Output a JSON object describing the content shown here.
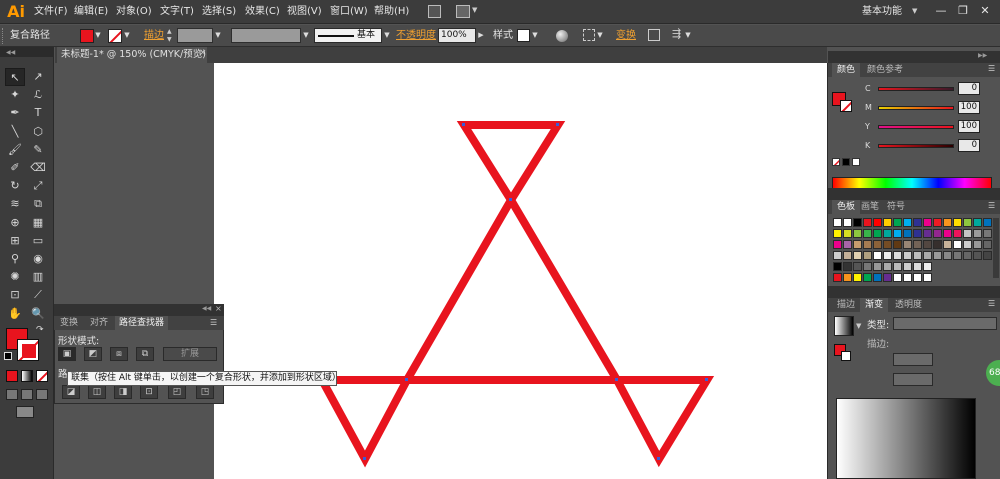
{
  "app": {
    "logo": "Ai"
  },
  "menu": [
    {
      "label": "文件(F)"
    },
    {
      "label": "编辑(E)"
    },
    {
      "label": "对象(O)"
    },
    {
      "label": "文字(T)"
    },
    {
      "label": "选择(S)"
    },
    {
      "label": "效果(C)"
    },
    {
      "label": "视图(V)"
    },
    {
      "label": "窗口(W)"
    },
    {
      "label": "帮助(H)"
    }
  ],
  "workspace": {
    "label": "基本功能"
  },
  "window_controls": {
    "minimize": "—",
    "maximize": "❐",
    "close": "✕"
  },
  "control": {
    "selection_type": "复合路径",
    "fill_color": "#e8141e",
    "stroke_label": "描边",
    "stroke_style_label": "基本",
    "opacity_label": "不透明度",
    "opacity_value": "100%",
    "style_label": "样式",
    "transform_label": "变换"
  },
  "document": {
    "tab_title": "未标题-1* @ 150% (CMYK/预览)"
  },
  "tools": [
    {
      "name": "selection-tool",
      "glyph": "↖"
    },
    {
      "name": "direct-selection-tool",
      "glyph": "↗"
    },
    {
      "name": "magic-wand-tool",
      "glyph": "✦"
    },
    {
      "name": "lasso-tool",
      "glyph": "ℒ"
    },
    {
      "name": "pen-tool",
      "glyph": "✒"
    },
    {
      "name": "type-tool",
      "glyph": "T"
    },
    {
      "name": "line-tool",
      "glyph": "╲"
    },
    {
      "name": "ellipse-tool",
      "glyph": "⬡"
    },
    {
      "name": "paintbrush-tool",
      "glyph": "🖌"
    },
    {
      "name": "pencil-tool",
      "glyph": "✎"
    },
    {
      "name": "blob-brush-tool",
      "glyph": "✐"
    },
    {
      "name": "eraser-tool",
      "glyph": "⌫"
    },
    {
      "name": "rotate-tool",
      "glyph": "↻"
    },
    {
      "name": "scale-tool",
      "glyph": "⤢"
    },
    {
      "name": "width-tool",
      "glyph": "≋"
    },
    {
      "name": "free-transform-tool",
      "glyph": "⧉"
    },
    {
      "name": "shape-builder-tool",
      "glyph": "⊕"
    },
    {
      "name": "perspective-grid-tool",
      "glyph": "▦"
    },
    {
      "name": "mesh-tool",
      "glyph": "⊞"
    },
    {
      "name": "gradient-tool",
      "glyph": "▭"
    },
    {
      "name": "eyedropper-tool",
      "glyph": "⚲"
    },
    {
      "name": "blend-tool",
      "glyph": "◉"
    },
    {
      "name": "symbol-sprayer-tool",
      "glyph": "✺"
    },
    {
      "name": "column-graph-tool",
      "glyph": "▥"
    },
    {
      "name": "artboard-tool",
      "glyph": "⊡"
    },
    {
      "name": "slice-tool",
      "glyph": "⟋"
    },
    {
      "name": "hand-tool",
      "glyph": "✋"
    },
    {
      "name": "zoom-tool",
      "glyph": "🔍"
    }
  ],
  "pathfinder": {
    "tabs": [
      {
        "label": "变换"
      },
      {
        "label": "对齐"
      },
      {
        "label": "路径查找器"
      }
    ],
    "shape_modes_label": "形状模式:",
    "expand_label": "扩展",
    "pathfinders_label": "路",
    "tooltip": "联集（按住 Alt 键单击，以创建一个复合形状，并添加到形状区域）"
  },
  "color_panel": {
    "tabs": [
      {
        "label": "颜色"
      },
      {
        "label": "颜色参考"
      }
    ],
    "channels": [
      {
        "label": "C",
        "value": "0"
      },
      {
        "label": "M",
        "value": "100"
      },
      {
        "label": "Y",
        "value": "100"
      },
      {
        "label": "K",
        "value": "0"
      }
    ]
  },
  "swatches_panel": {
    "tabs": [
      {
        "label": "色板"
      },
      {
        "label": "画笔"
      },
      {
        "label": "符号"
      }
    ]
  },
  "gradient_panel": {
    "tabs": [
      {
        "label": "描边"
      },
      {
        "label": "渐变"
      },
      {
        "label": "透明度"
      }
    ],
    "type_label": "类型:",
    "stroke_label": "描边:"
  },
  "badge": {
    "text": "68"
  },
  "colors": {
    "accent_red": "#e8141e",
    "ui_dark": "#3c3c3c",
    "ui_mid": "#535353"
  }
}
